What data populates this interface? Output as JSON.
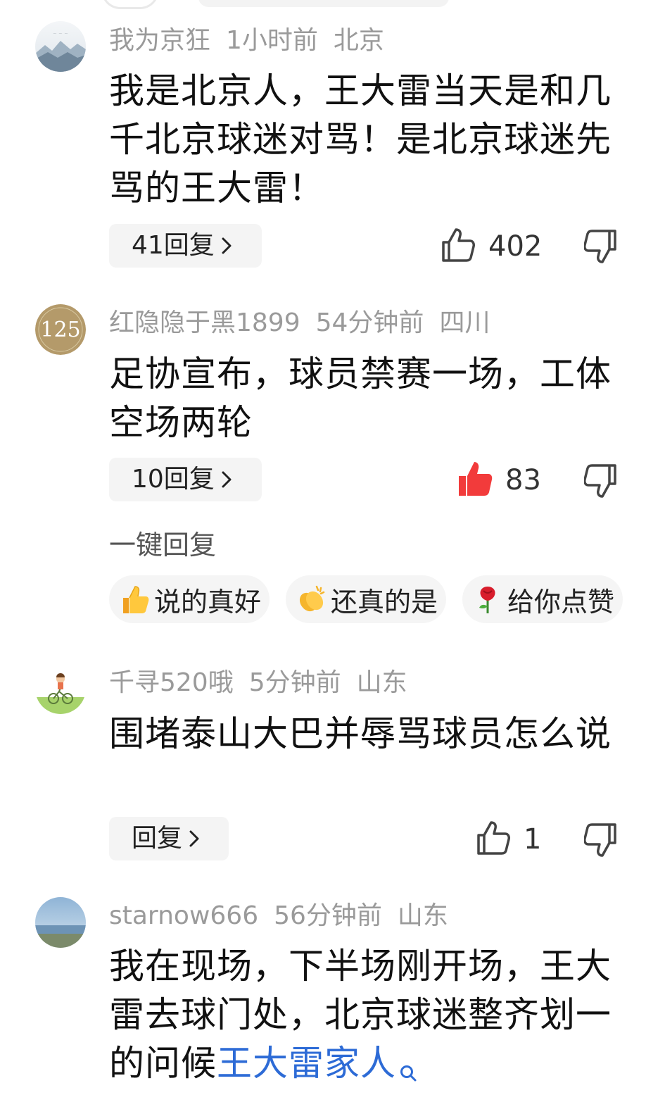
{
  "comments": [
    {
      "username": "我为京狂",
      "time": "1小时前",
      "location": "北京",
      "text": "我是北京人，王大雷当天是和几千北京球迷对骂！是北京球迷先骂的王大雷！",
      "reply_label": "41回复",
      "likes": "402",
      "liked": false
    },
    {
      "username": "红隐隐于黑1899",
      "time": "54分钟前",
      "location": "四川",
      "text": "足协宣布，球员禁赛一场，工体空场两轮",
      "reply_label": "10回复",
      "likes": "83",
      "liked": true
    },
    {
      "username": "千寻520哦",
      "time": "5分钟前",
      "location": "山东",
      "text": "围堵泰山大巴并辱骂球员怎么说",
      "reply_label": "回复",
      "likes": "1",
      "liked": false
    },
    {
      "username": "starnow666",
      "time": "56分钟前",
      "location": "山东",
      "text_plain": "我在现场，下半场刚开场，王大雷去球门处，北京球迷整齐划一的问候",
      "text_link": "王大雷家人"
    }
  ],
  "quick_reply": {
    "title": "一键回复",
    "chips": [
      {
        "emoji": "thumbs-up-emoji",
        "label": "说的真好"
      },
      {
        "emoji": "clapping-hands-emoji",
        "label": "还真的是"
      },
      {
        "emoji": "rose-emoji",
        "label": "给你点赞"
      }
    ]
  },
  "avatar_badge_text": "125",
  "colors": {
    "meta_gray": "#9a9a9a",
    "liked_red": "#f23b3b",
    "link_blue": "#2d6bd6"
  }
}
